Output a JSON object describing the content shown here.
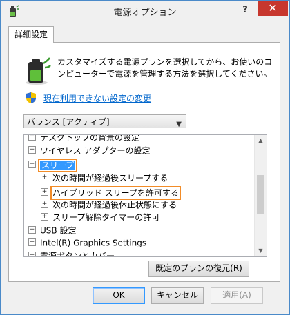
{
  "window": {
    "title": "電源オプション",
    "help_label": "?",
    "close_label": "✕"
  },
  "tab": {
    "label": "詳細設定"
  },
  "panel": {
    "description": "カスタマイズする電源プランを選択してから、お使いのコンピューターで電源を管理する方法を選択してください。",
    "change_settings_link": "現在利用できない設定の変更",
    "plan_select_value": "バランス [アクティブ]"
  },
  "tree": {
    "items": [
      {
        "label": "デスクトップの背景の設定",
        "expander": "+"
      },
      {
        "label": "ワイヤレス アダプターの設定",
        "expander": "+"
      },
      {
        "label": "スリープ",
        "expander": "−"
      },
      {
        "label": "次の時間が経過後スリープする",
        "expander": "+"
      },
      {
        "label": "ハイブリッド スリープを許可する",
        "expander": "+"
      },
      {
        "label": "次の時間が経過後休止状態にする",
        "expander": "+"
      },
      {
        "label": "スリープ解除タイマーの許可",
        "expander": "+"
      },
      {
        "label": "USB 設定",
        "expander": "+"
      },
      {
        "label": "Intel(R) Graphics Settings",
        "expander": "+"
      },
      {
        "label": "電源ボタンとカバー",
        "expander": "+"
      }
    ]
  },
  "buttons": {
    "restore_defaults": "既定のプランの復元(R)",
    "ok": "OK",
    "cancel": "キャンセル",
    "apply": "適用(A)"
  },
  "colors": {
    "selection": "#3399ff",
    "highlight_outline": "#f28c28",
    "link": "#0066cc",
    "close_button": "#c7372e"
  }
}
